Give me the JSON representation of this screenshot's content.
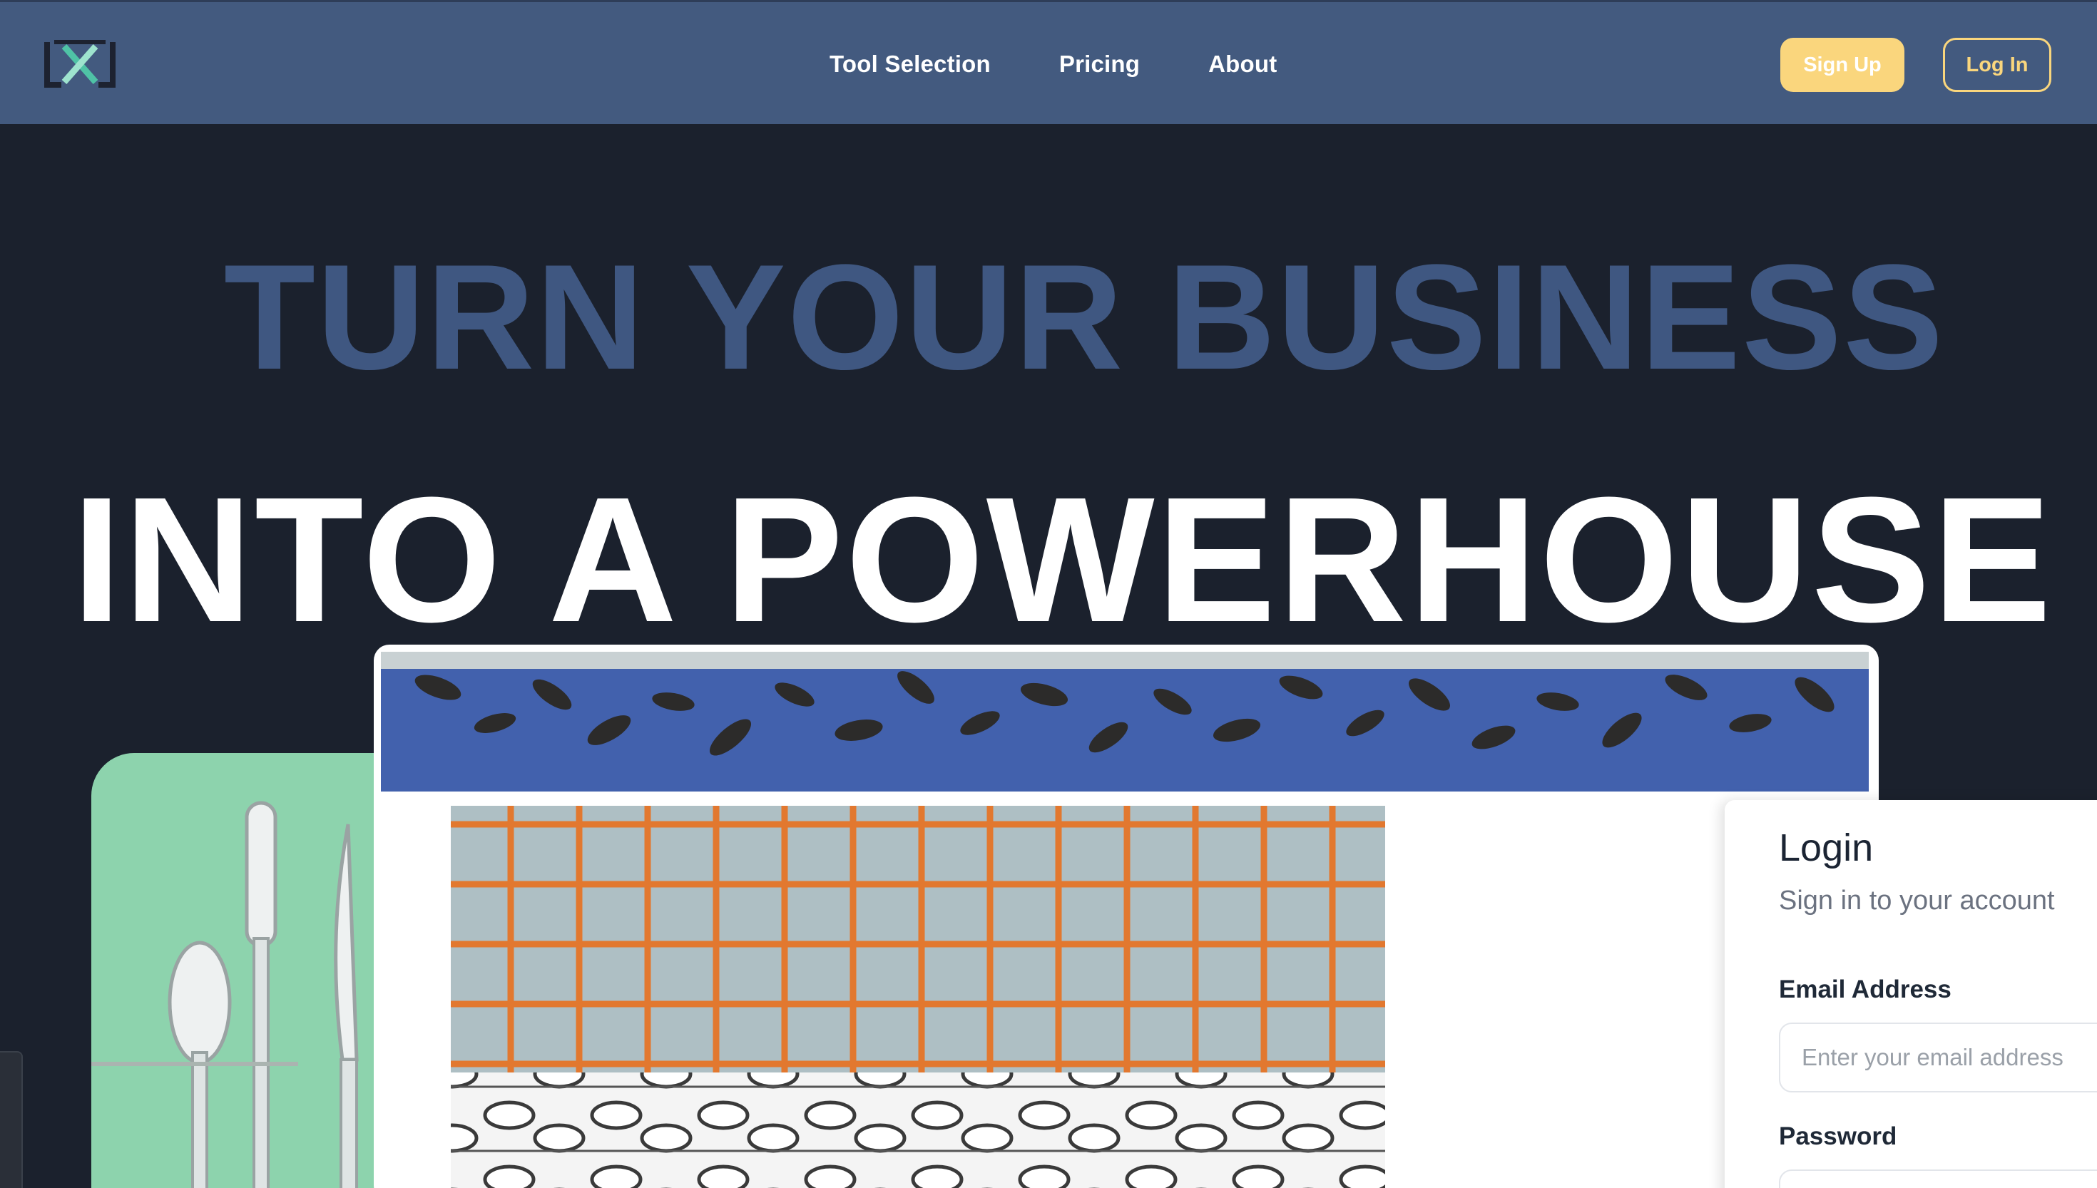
{
  "header": {
    "logo_icon": "brand-logo-icon",
    "nav": [
      {
        "label": "Tool Selection"
      },
      {
        "label": "Pricing"
      },
      {
        "label": "About"
      }
    ],
    "signup_label": "Sign Up",
    "login_label": "Log In",
    "colors": {
      "bar": "#435a7f",
      "accent": "#fad67d"
    }
  },
  "hero": {
    "line1": "TURN YOUR BUSINESS",
    "line2": "INTO A POWERHOUSE"
  },
  "login_card": {
    "title": "Login",
    "subtitle": "Sign in to your account",
    "email_label": "Email Address",
    "email_placeholder": "Enter your email address",
    "password_label": "Password"
  }
}
